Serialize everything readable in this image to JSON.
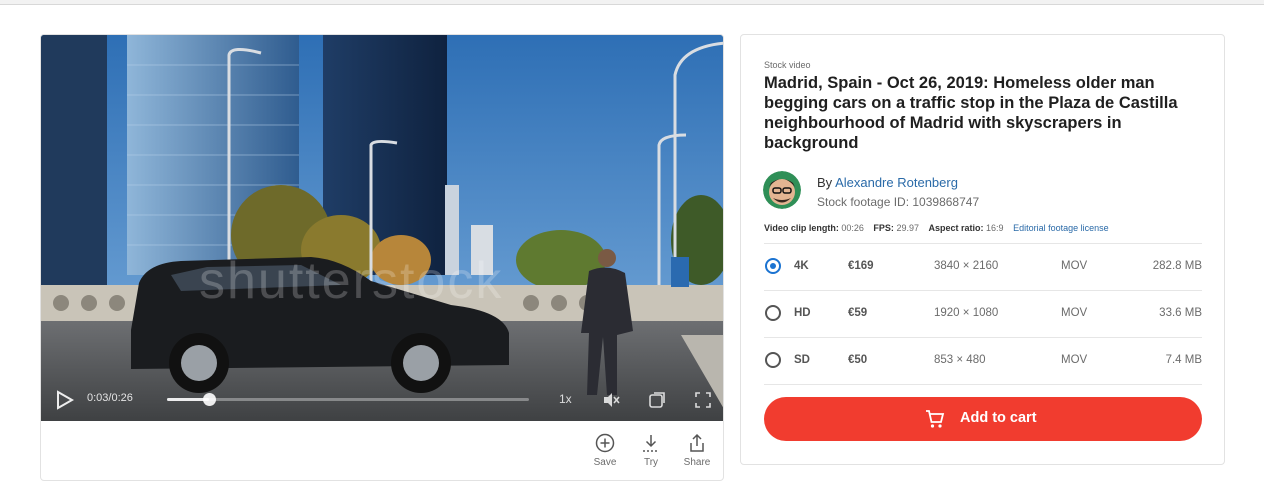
{
  "video": {
    "watermark": "shutterstock",
    "current_time": "0:03",
    "duration": "0:26",
    "progress_fraction": 0.115,
    "speed": "1x",
    "icons": [
      "play-icon",
      "volume-muted-icon",
      "preview-icon",
      "fullscreen-icon"
    ]
  },
  "actions": [
    {
      "label": "Save",
      "icon": "add-circle-icon"
    },
    {
      "label": "Try",
      "icon": "download-icon"
    },
    {
      "label": "Share",
      "icon": "share-icon"
    }
  ],
  "info": {
    "kicker": "Stock video",
    "title": "Madrid, Spain - Oct 26, 2019: Homeless older man begging cars on a traffic stop in the Plaza de Castilla neighbourhood of Madrid with skyscrapers in background",
    "by_prefix": "By",
    "author": "Alexandre Rotenberg",
    "stock_id": "Stock footage ID: 1039868747",
    "meta": {
      "length_label": "Video clip length:",
      "length": "00:26",
      "fps_label": "FPS:",
      "fps": "29.97",
      "aspect_label": "Aspect ratio:",
      "aspect": "16:9",
      "license_link": "Editorial footage license"
    }
  },
  "options": [
    {
      "quality": "4K",
      "price": "€169",
      "resolution": "3840 × 2160",
      "format": "MOV",
      "size": "282.8 MB",
      "selected": true
    },
    {
      "quality": "HD",
      "price": "€59",
      "resolution": "1920 × 1080",
      "format": "MOV",
      "size": "33.6 MB",
      "selected": false
    },
    {
      "quality": "SD",
      "price": "€50",
      "resolution": "853 × 480",
      "format": "MOV",
      "size": "7.4 MB",
      "selected": false
    }
  ],
  "cart_button": {
    "label": "Add to cart",
    "icon": "cart-icon",
    "color": "#f13c2f"
  },
  "colors": {
    "accent": "#1b73d1",
    "link": "#2a6aa8"
  }
}
